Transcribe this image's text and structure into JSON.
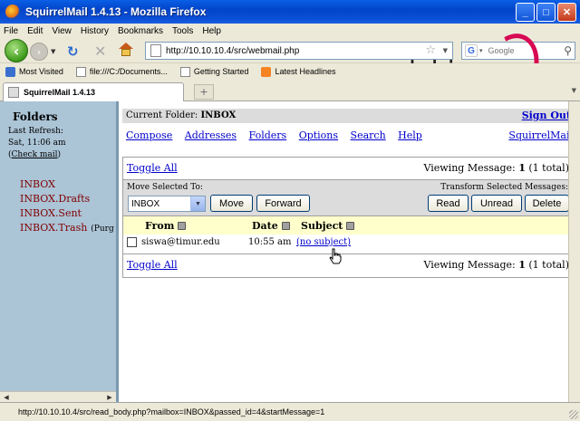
{
  "window": {
    "title": "SquirrelMail 1.4.13 - Mozilla Firefox",
    "min": "_",
    "max": "□",
    "close": "✕"
  },
  "menu": [
    "File",
    "Edit",
    "View",
    "History",
    "Bookmarks",
    "Tools",
    "Help"
  ],
  "nav": {
    "url": "http://10.10.10.4/src/webmail.php",
    "search_placeholder": "Google"
  },
  "bookmarks": [
    {
      "label": "Most Visited",
      "icon": "most-visited-icon"
    },
    {
      "label": "file:///C:/Documents...",
      "icon": "page-icon"
    },
    {
      "label": "Getting Started",
      "icon": "page-icon"
    },
    {
      "label": "Latest Headlines",
      "icon": "rss-icon"
    }
  ],
  "banner": {
    "text": "debian"
  },
  "tab": {
    "label": "SquirrelMail 1.4.13",
    "new_tab": "+"
  },
  "left": {
    "heading": "Folders",
    "last_refresh_label": "Last Refresh:",
    "last_refresh_time": "Sat, 11:06 am",
    "check_mail": "Check mail",
    "folders": [
      "INBOX",
      "INBOX.Drafts",
      "INBOX.Sent",
      "INBOX.Trash"
    ],
    "purge": "(Purg"
  },
  "main": {
    "current_folder_label": "Current Folder:",
    "current_folder": "INBOX",
    "sign_out": "Sign Out",
    "links": [
      "Compose",
      "Addresses",
      "Folders",
      "Options",
      "Search",
      "Help"
    ],
    "squirrelmail_link": "SquirrelMail",
    "toggle_all": "Toggle All",
    "viewing_prefix": "Viewing Message:",
    "viewing_num": "1",
    "viewing_total": "(1 total)",
    "move_selected_to": "Move Selected To:",
    "transform_label": "Transform Selected Messages:",
    "folder_select_value": "INBOX",
    "buttons": {
      "move": "Move",
      "forward": "Forward",
      "read": "Read",
      "unread": "Unread",
      "delete": "Delete"
    },
    "columns": {
      "from": "From",
      "date": "Date",
      "subject": "Subject"
    },
    "messages": [
      {
        "from": "siswa@timur.edu",
        "date": "10:55 am",
        "subject": "(no subject)"
      }
    ]
  },
  "status": {
    "text": "http://10.10.10.4/src/read_body.php?mailbox=INBOX&passed_id=4&startMessage=1"
  }
}
